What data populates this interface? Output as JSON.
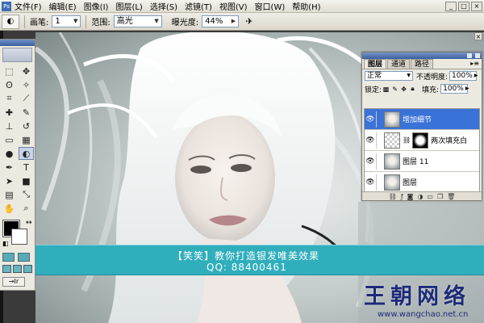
{
  "menu": {
    "app_icon": "Ps",
    "items": [
      "文件(F)",
      "编辑(E)",
      "图像(I)",
      "图层(L)",
      "选择(S)",
      "滤镜(T)",
      "视图(V)",
      "窗口(W)",
      "帮助(H)"
    ],
    "window_controls": [
      "_",
      "□",
      "×"
    ]
  },
  "options": {
    "tool_icon": "dodge-tool-icon",
    "brush_label": "画笔:",
    "brush_size": "1",
    "range_label": "范围:",
    "range_value": "高光",
    "exposure_label": "曝光度:",
    "exposure_value": "44%",
    "airbrush_icon": "airbrush-icon"
  },
  "toolbox": {
    "tools": [
      {
        "name": "marquee-icon",
        "glyph": "⬚"
      },
      {
        "name": "move-icon",
        "glyph": "✥"
      },
      {
        "name": "lasso-icon",
        "glyph": "ʘ"
      },
      {
        "name": "magic-wand-icon",
        "glyph": "✧"
      },
      {
        "name": "crop-icon",
        "glyph": "⌗"
      },
      {
        "name": "slice-icon",
        "glyph": "⟋"
      },
      {
        "name": "healing-brush-icon",
        "glyph": "✚"
      },
      {
        "name": "brush-icon",
        "glyph": "✎"
      },
      {
        "name": "clone-stamp-icon",
        "glyph": "⊥"
      },
      {
        "name": "history-brush-icon",
        "glyph": "↺"
      },
      {
        "name": "eraser-icon",
        "glyph": "▭"
      },
      {
        "name": "gradient-icon",
        "glyph": "▦"
      },
      {
        "name": "blur-icon",
        "glyph": "●"
      },
      {
        "name": "dodge-icon",
        "glyph": "◐"
      },
      {
        "name": "pen-icon",
        "glyph": "✒"
      },
      {
        "name": "type-icon",
        "glyph": "T"
      },
      {
        "name": "path-selection-icon",
        "glyph": "➤"
      },
      {
        "name": "shape-icon",
        "glyph": "■"
      },
      {
        "name": "notes-icon",
        "glyph": "▤"
      },
      {
        "name": "eyedropper-icon",
        "glyph": "⤡"
      },
      {
        "name": "hand-icon",
        "glyph": "✋"
      },
      {
        "name": "zoom-icon",
        "glyph": "⌕"
      }
    ],
    "active_tool": "dodge-icon",
    "foreground_color": "#000000",
    "background_color": "#ffffff",
    "jump_label": "→Ir"
  },
  "banner": {
    "line1": "【笑笑】教你打造银发唯美效果",
    "line2": "QQ: 88400461",
    "color": "#30aebc"
  },
  "watermark": {
    "logo": "王朝网络",
    "url": "www.wangchao.net.cn"
  },
  "layers_panel": {
    "tabs": [
      "图层",
      "通道",
      "路径"
    ],
    "menu_icon": "▸≡",
    "blend_mode": "正常",
    "opacity_label": "不透明度:",
    "opacity_value": "100%",
    "lock_label": "锁定:",
    "fill_label": "填充:",
    "fill_value": "100%",
    "layers": [
      {
        "name": "增加细节",
        "visible": true,
        "selected": true,
        "thumb": "face",
        "mask": false
      },
      {
        "name": "两次填充白",
        "visible": true,
        "selected": false,
        "thumb": "check",
        "mask": true
      },
      {
        "name": "图层 11",
        "visible": true,
        "selected": false,
        "thumb": "face",
        "mask": false
      },
      {
        "name": "图层",
        "visible": true,
        "selected": false,
        "thumb": "face",
        "mask": false
      }
    ],
    "footer_icons": [
      "link-icon",
      "fx-icon",
      "mask-icon",
      "adjustment-icon",
      "group-icon",
      "new-layer-icon",
      "trash-icon"
    ],
    "selected_color": "#3a73d8"
  }
}
